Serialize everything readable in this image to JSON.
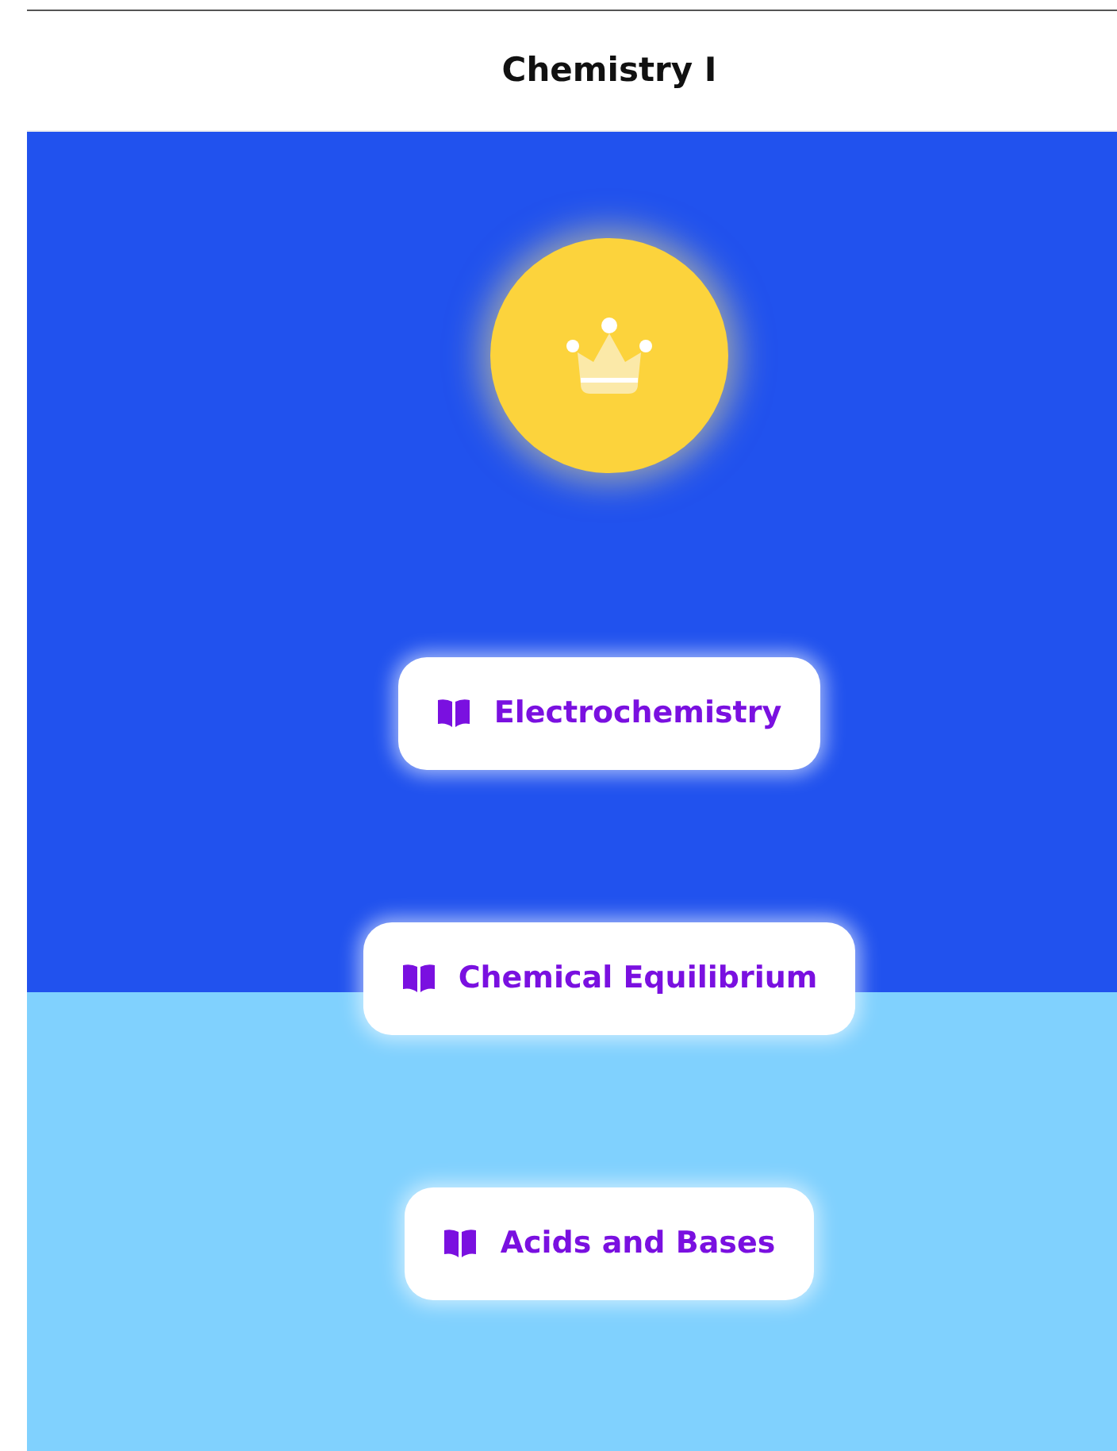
{
  "header": {
    "title": "Chemistry I"
  },
  "topics": [
    {
      "label": "Electrochemistry"
    },
    {
      "label": "Chemical Equilibrium"
    },
    {
      "label": "Acids and Bases"
    }
  ]
}
